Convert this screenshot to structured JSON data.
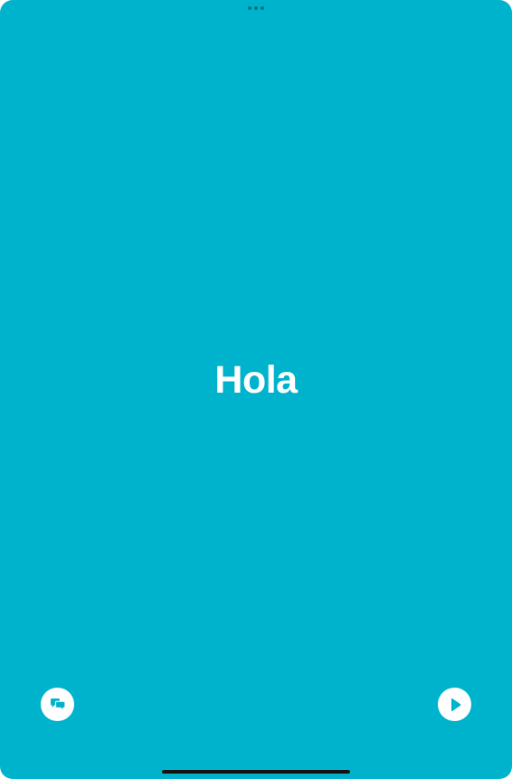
{
  "colors": {
    "background": "#00B3CC",
    "text": "#FFFFFF",
    "button_bg": "#FFFFFF",
    "icon": "#00B3CC",
    "home_indicator": "#111111"
  },
  "card": {
    "text": "Hola"
  },
  "buttons": {
    "left_icon": "chat-bubbles-icon",
    "right_icon": "play-icon"
  }
}
